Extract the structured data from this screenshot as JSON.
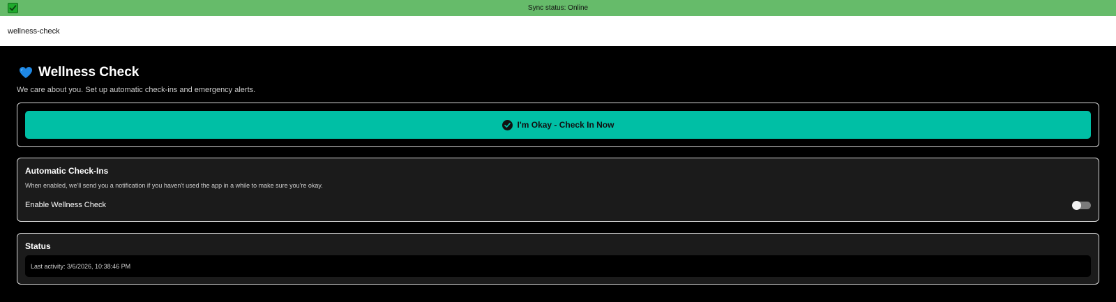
{
  "sync": {
    "icon": "check-box-icon",
    "text": "Sync status: Online",
    "color": "#66bb6a"
  },
  "route": {
    "name": "wellness-check"
  },
  "header": {
    "icon": "heart-icon",
    "title": "Wellness Check",
    "subtitle": "We care about you. Set up automatic check-ins and emergency alerts."
  },
  "checkin": {
    "icon": "check-circle-icon",
    "label": "I'm Okay - Check In Now",
    "color": "#00bfa5"
  },
  "auto_checkins": {
    "title": "Automatic Check-Ins",
    "description": "When enabled, we'll send you a notification if you haven't used the app in a while to make sure you're okay.",
    "toggle_label": "Enable Wellness Check",
    "toggle_enabled": false
  },
  "status": {
    "title": "Status",
    "last_activity": "Last activity: 3/6/2026, 10:38:46 PM"
  }
}
